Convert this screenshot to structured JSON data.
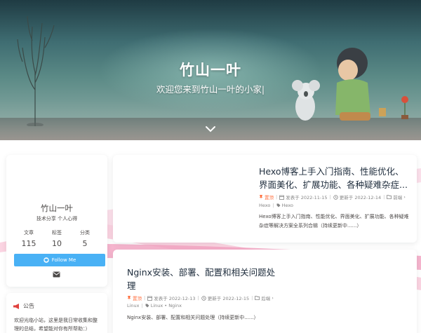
{
  "hero": {
    "title": "竹山一叶",
    "subtitle": "欢迎您来到竹山一叶的小家|"
  },
  "author": {
    "name": "竹山一叶",
    "description": "技术分享 个人心得",
    "stats": [
      {
        "label": "文章",
        "count": "115"
      },
      {
        "label": "标签",
        "count": "10"
      },
      {
        "label": "分类",
        "count": "5"
      }
    ],
    "follow_label": "Follow Me"
  },
  "notice": {
    "title": "公告",
    "text": "欢迎光临小站，这里是我日常收集和整理的总结，希望能对你有所帮助：）"
  },
  "posts": [
    {
      "title": "Hexo博客上手入门指南、性能优化、界面美化、扩展功能、各种疑难杂症...",
      "sticky": "置顶",
      "published": "发表于 2022-11-15",
      "updated": "更新于 2022-12-14",
      "category": "前端",
      "tags": [
        "Hexo",
        "Hexo"
      ],
      "excerpt": "Hexo博客上手入门指南、性能优化、界面美化、扩展功能、各种疑难杂症等解决方案全系列合辑（持续更新中......）"
    },
    {
      "title": "Nginx安装、部署、配置和相关问题处理",
      "sticky": "置顶",
      "published": "发表于 2022-12-13",
      "updated": "更新于 2022-12-15",
      "category": "后端",
      "tags": [
        "Linux",
        "Linux • Nginx"
      ],
      "excerpt": "Nginx安装、部署、配置和相关问题处理（持续更新中......）"
    }
  ],
  "colors": {
    "accent": "#49b1f5",
    "sticky": "#ff7242",
    "notice_icon": "#e0433f",
    "decor_pink": "#f4a3c2"
  }
}
